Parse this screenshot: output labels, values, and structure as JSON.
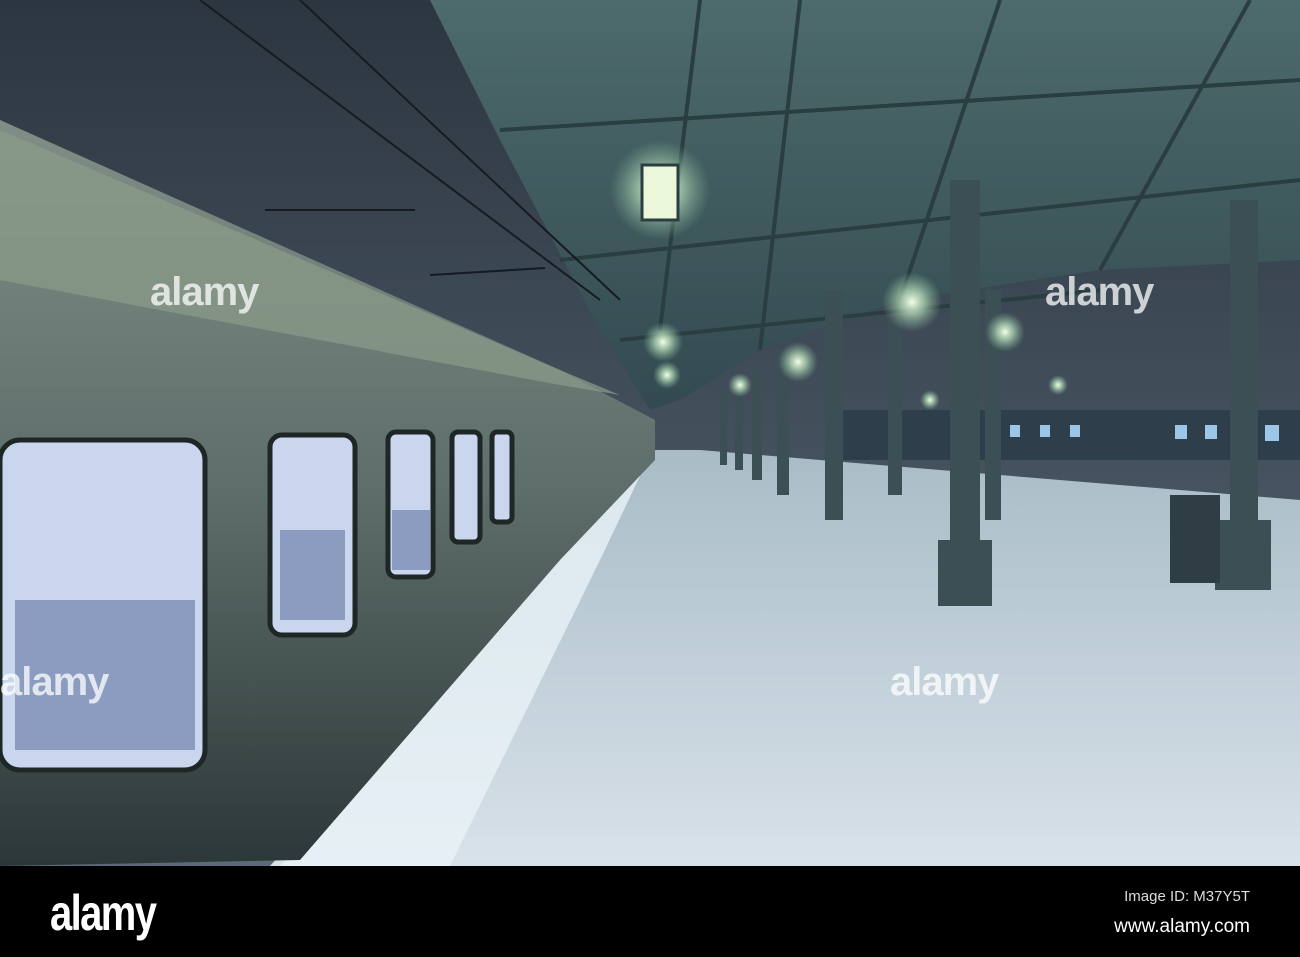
{
  "photo": {
    "subject": "Snowy railway platform at night"
  },
  "watermark": {
    "text": "alamy"
  },
  "footer": {
    "logo": "alamy",
    "image_id": "Image ID: M37Y5T",
    "website": "www.alamy.com"
  }
}
